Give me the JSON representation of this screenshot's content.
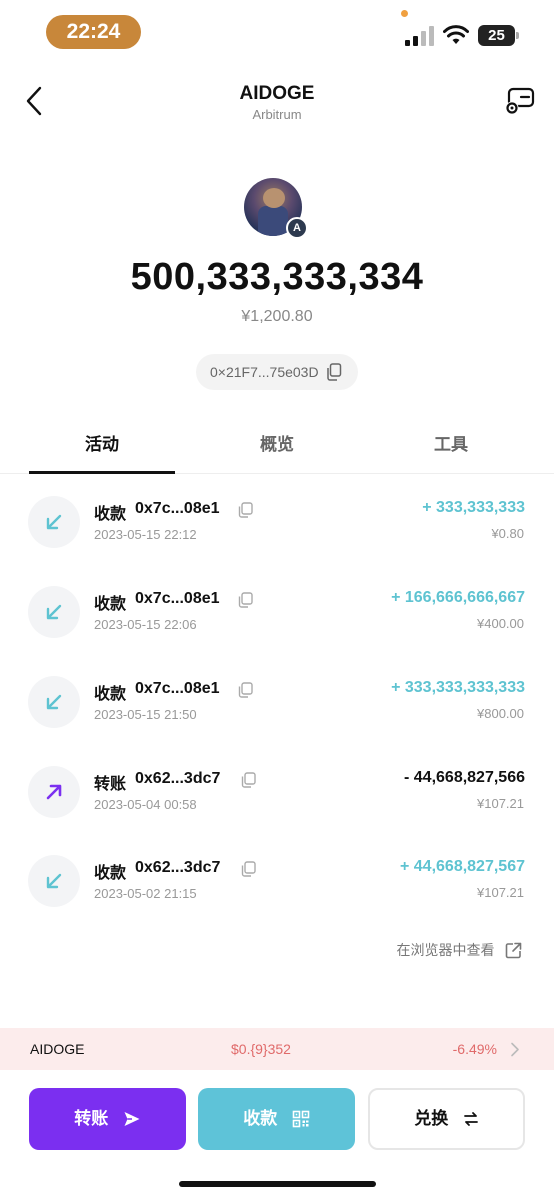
{
  "status_bar": {
    "time": "22:24",
    "battery": "25"
  },
  "header": {
    "title": "AIDOGE",
    "subtitle": "Arbitrum"
  },
  "token": {
    "balance": "500,333,333,334",
    "fiat_value": "¥1,200.80",
    "address": "0×21F7...75e03D"
  },
  "tabs": [
    {
      "label": "活动",
      "active": true
    },
    {
      "label": "概览",
      "active": false
    },
    {
      "label": "工具",
      "active": false
    }
  ],
  "transactions": [
    {
      "type": "收款",
      "address": "0x7c...08e1",
      "date": "2023-05-15 22:12",
      "amount": "+ 333,333,333",
      "fiat": "¥0.80",
      "direction": "in"
    },
    {
      "type": "收款",
      "address": "0x7c...08e1",
      "date": "2023-05-15 22:06",
      "amount": "+ 166,666,666,667",
      "fiat": "¥400.00",
      "direction": "in"
    },
    {
      "type": "收款",
      "address": "0x7c...08e1",
      "date": "2023-05-15 21:50",
      "amount": "+ 333,333,333,333",
      "fiat": "¥800.00",
      "direction": "in"
    },
    {
      "type": "转账",
      "address": "0x62...3dc7",
      "date": "2023-05-04 00:58",
      "amount": "- 44,668,827,566",
      "fiat": "¥107.21",
      "direction": "out"
    },
    {
      "type": "收款",
      "address": "0x62...3dc7",
      "date": "2023-05-02 21:15",
      "amount": "+ 44,668,827,567",
      "fiat": "¥107.21",
      "direction": "in"
    }
  ],
  "explorer_link": "在浏览器中查看",
  "price_bar": {
    "symbol": "AIDOGE",
    "price": "$0.{9}352",
    "change": "-6.49%"
  },
  "actions": {
    "transfer": "转账",
    "receive": "收款",
    "swap": "兑换"
  },
  "colors": {
    "incoming": "#5ec3d1",
    "outgoing": "#7b2ff0",
    "negative": "#e06a6a",
    "primary_button": "#7b2ff0",
    "receive_button": "#5ec3d8"
  }
}
